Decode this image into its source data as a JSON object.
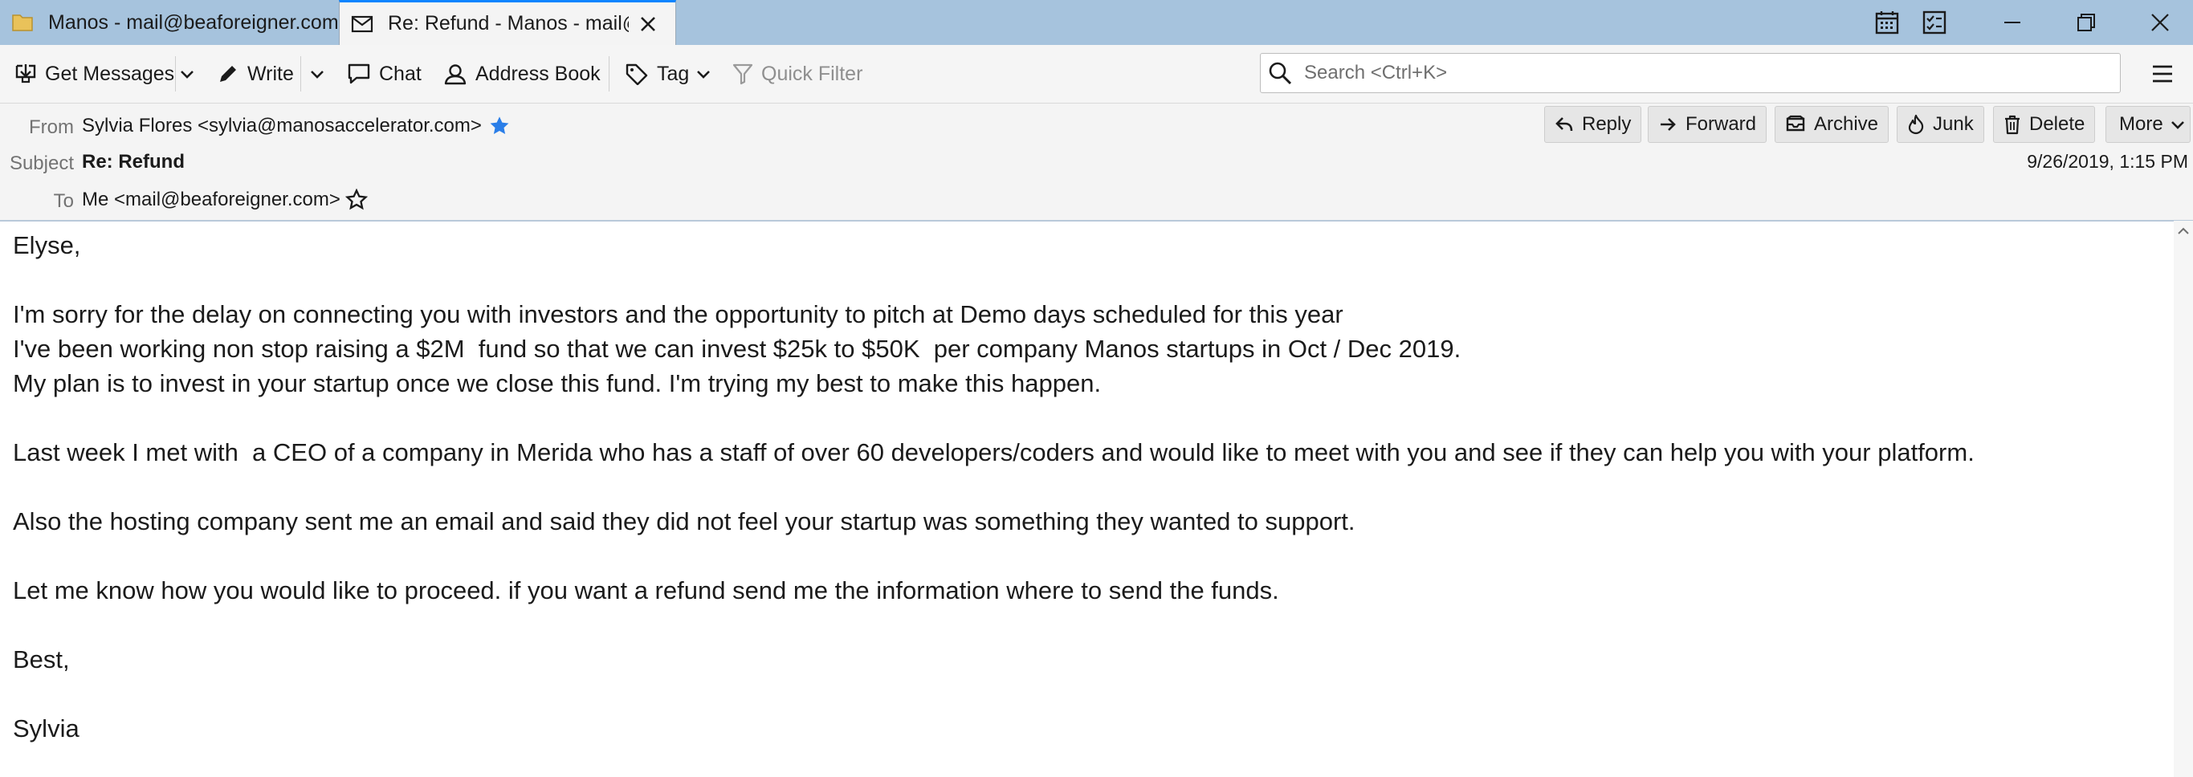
{
  "tabs": [
    {
      "label": "Manos - mail@beaforeigner.com",
      "icon": "folder-icon"
    },
    {
      "label": "Re: Refund - Manos - mail@beaforeigner.com",
      "icon": "envelope-icon"
    }
  ],
  "toolbar": {
    "get_messages": "Get Messages",
    "write": "Write",
    "chat": "Chat",
    "address_book": "Address Book",
    "tag": "Tag",
    "quick_filter": "Quick Filter",
    "search_placeholder": "Search <Ctrl+K>"
  },
  "header": {
    "from_label": "From",
    "from_value": "Sylvia Flores <sylvia@manosaccelerator.com>",
    "subject_label": "Subject",
    "subject_value": "Re: Refund",
    "to_label": "To",
    "to_value": "Me <mail@beaforeigner.com>",
    "date": "9/26/2019, 1:15 PM",
    "actions": {
      "reply": "Reply",
      "forward": "Forward",
      "archive": "Archive",
      "junk": "Junk",
      "delete": "Delete",
      "more": "More"
    }
  },
  "body": {
    "lines": [
      "Elyse,",
      "",
      "I'm sorry for the delay on connecting you with investors and the opportunity to pitch at Demo days scheduled for this year",
      "I've been working non stop raising a $2M  fund so that we can invest $25k to $50K  per company Manos startups in Oct / Dec 2019.",
      "My plan is to invest in your startup once we close this fund. I'm trying my best to make this happen.",
      "",
      "Last week I met with  a CEO of a company in Merida who has a staff of over 60 developers/coders and would like to meet with you and see if they can help you with your platform.",
      "",
      "Also the hosting company sent me an email and said they did not feel your startup was something they wanted to support.",
      "",
      "Let me know how you would like to proceed. if you want a refund send me the information where to send the funds.",
      "",
      "Best,",
      "",
      "Sylvia"
    ]
  },
  "colors": {
    "tabbar_bg": "#a6c3dd",
    "active_tab_accent": "#0a84ff",
    "star_starred": "#2a7ee8"
  }
}
